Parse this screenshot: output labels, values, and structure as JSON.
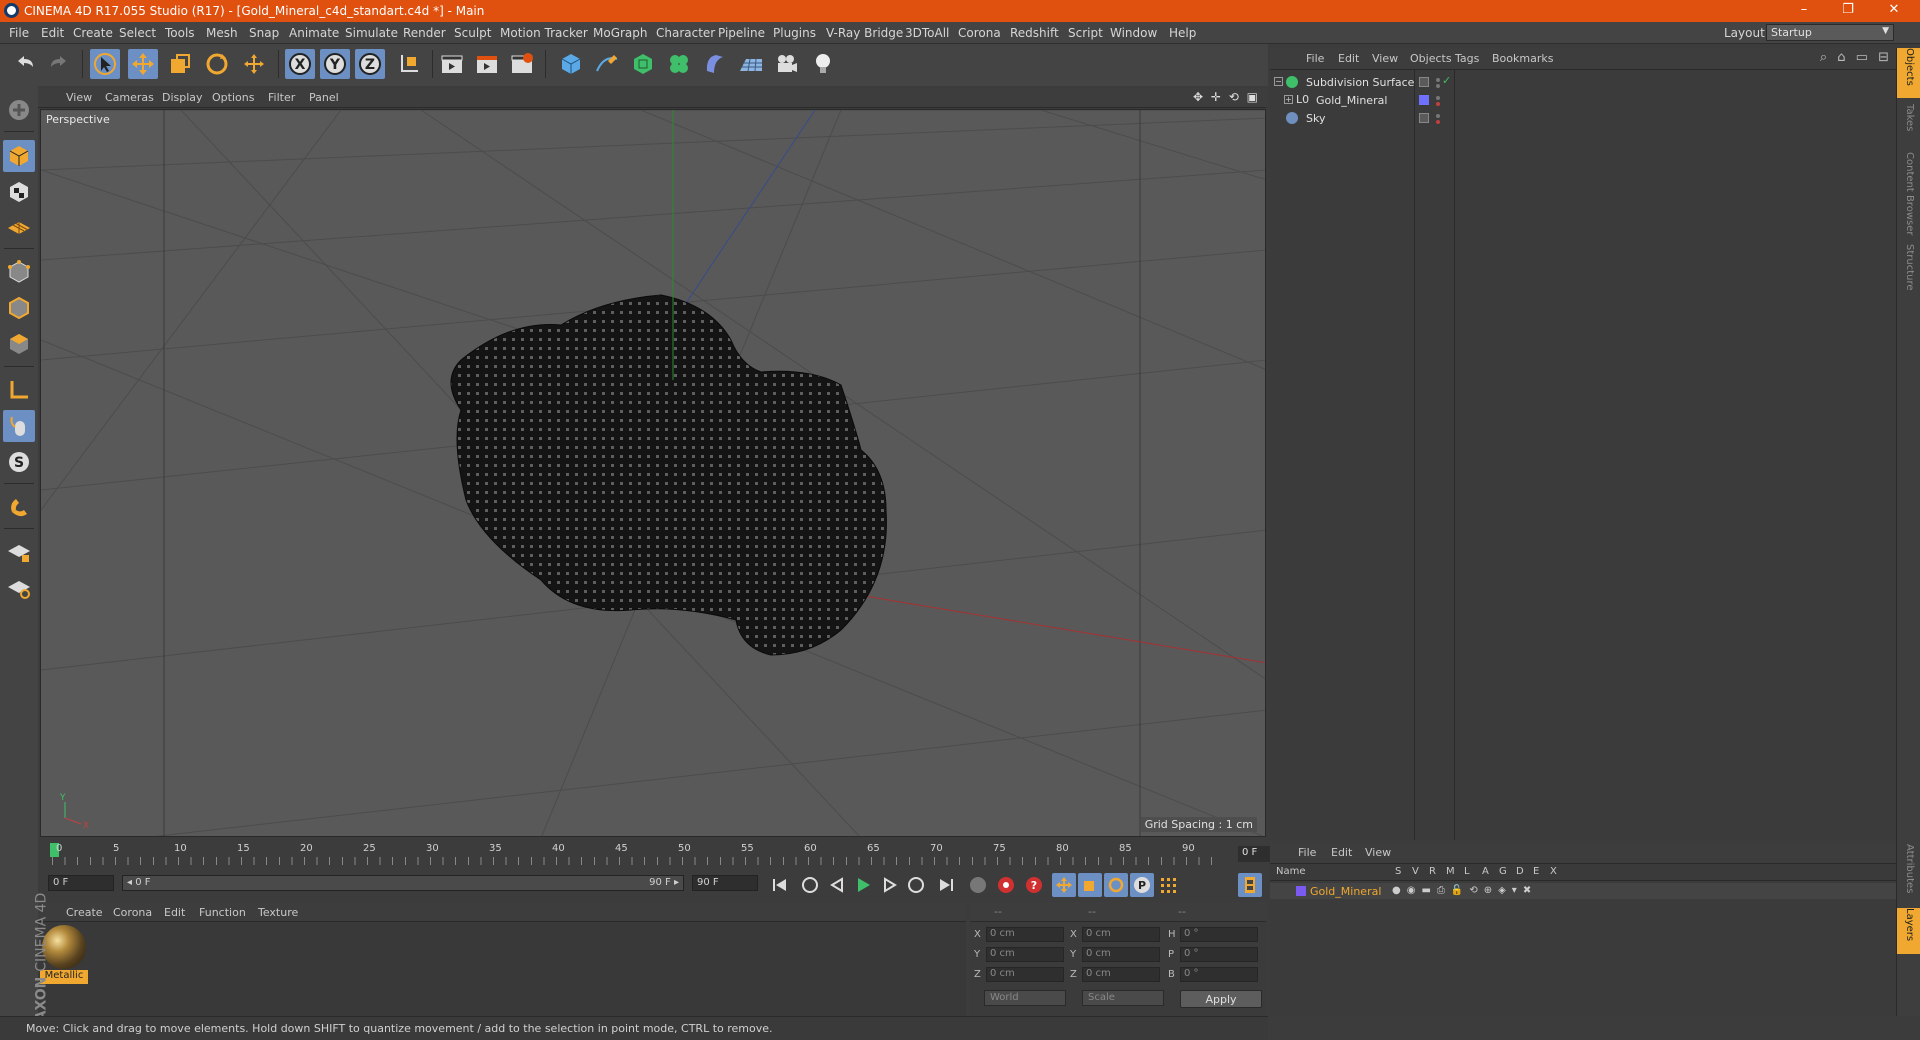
{
  "window": {
    "title": "CINEMA 4D R17.055 Studio (R17) - [Gold_Mineral_c4d_standart.c4d *] - Main",
    "minimize": "–",
    "restore": "❐",
    "close": "✕"
  },
  "menu": {
    "items": [
      "File",
      "Edit",
      "Create",
      "Select",
      "Tools",
      "Mesh",
      "Snap",
      "Animate",
      "Simulate",
      "Render",
      "Sculpt",
      "Motion Tracker",
      "MoGraph",
      "Character",
      "Pipeline",
      "Plugins",
      "V-Ray Bridge",
      "3DToAll",
      "Corona",
      "Redshift",
      "Script",
      "Window",
      "Help"
    ],
    "layout_label": "Layout:",
    "layout_value": "Startup"
  },
  "viewport": {
    "menu": [
      "View",
      "Cameras",
      "Display",
      "Options",
      "Filter",
      "Panel"
    ],
    "label": "Perspective",
    "grid_spacing": "Grid Spacing : 1 cm",
    "axis_y": "Y",
    "axis_x": "X"
  },
  "timeline": {
    "ticks": [
      "0",
      "5",
      "10",
      "15",
      "20",
      "25",
      "30",
      "35",
      "40",
      "45",
      "50",
      "55",
      "60",
      "65",
      "70",
      "75",
      "80",
      "85",
      "90"
    ],
    "current_frame": "0 F"
  },
  "transport": {
    "start_field": "0 F",
    "range_start": "◂ 0 F",
    "range_end": "90 F ▸",
    "end_field": "90 F"
  },
  "material_manager": {
    "menu": [
      "Create",
      "Corona",
      "Edit",
      "Function",
      "Texture"
    ],
    "materials": [
      {
        "name": "Metallic"
      }
    ],
    "logo_line1": "MAXON",
    "logo_line2": "CINEMA 4D"
  },
  "coordinates": {
    "headers": [
      "--",
      "--",
      "--"
    ],
    "rows": [
      {
        "l1": "X",
        "v1": "0 cm",
        "l2": "X",
        "v2": "0 cm",
        "l3": "H",
        "v3": "0 °"
      },
      {
        "l1": "Y",
        "v1": "0 cm",
        "l2": "Y",
        "v2": "0 cm",
        "l3": "P",
        "v3": "0 °"
      },
      {
        "l1": "Z",
        "v1": "0 cm",
        "l2": "Z",
        "v2": "0 cm",
        "l3": "B",
        "v3": "0 °"
      }
    ],
    "mode": "World",
    "transform": "Scale",
    "apply": "Apply"
  },
  "status": {
    "text": "Move: Click and drag to move elements. Hold down SHIFT to quantize movement / add to the selection in point mode, CTRL to remove."
  },
  "object_manager": {
    "menu": [
      "File",
      "Edit",
      "View",
      "Objects",
      "Tags",
      "Bookmarks"
    ],
    "objects": [
      {
        "name": "Subdivision Surface",
        "color": "#3fbf6a"
      },
      {
        "name": "Gold_Mineral",
        "color": "#7070ff"
      },
      {
        "name": "Sky",
        "color": "#6f8fbf"
      }
    ]
  },
  "right_tabs": [
    "Objects",
    "Takes",
    "Content Browser",
    "Structure",
    "Attributes",
    "Layers"
  ],
  "layer_manager": {
    "menu": [
      "File",
      "Edit",
      "View"
    ],
    "columns": [
      "Name",
      "S",
      "V",
      "R",
      "M",
      "L",
      "A",
      "G",
      "D",
      "E",
      "X"
    ],
    "layers": [
      {
        "name": "Gold_Mineral",
        "color": "#7a5af0"
      }
    ]
  },
  "colors": {
    "accent": "#e0500e",
    "selection": "#6c8fc4",
    "highlight": "#f0a830"
  }
}
